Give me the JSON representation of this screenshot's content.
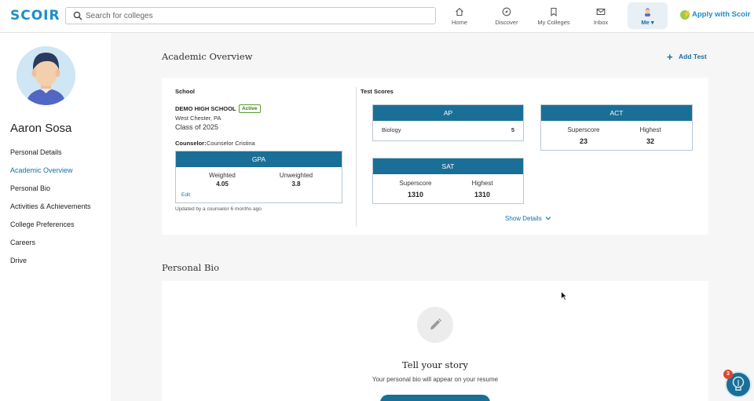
{
  "app": {
    "logo": "SCOIR"
  },
  "search": {
    "placeholder": "Search for colleges"
  },
  "nav": {
    "home": "Home",
    "discover": "Discover",
    "my_colleges": "My Colleges",
    "inbox": "Inbox",
    "me": "Me ▾",
    "apply": "Apply with Scoir"
  },
  "sidebar": {
    "name": "Aaron Sosa",
    "items": [
      {
        "label": "Personal Details"
      },
      {
        "label": "Academic Overview"
      },
      {
        "label": "Personal Bio"
      },
      {
        "label": "Activities & Achievements"
      },
      {
        "label": "College Preferences"
      },
      {
        "label": "Careers"
      },
      {
        "label": "Drive"
      }
    ]
  },
  "academic": {
    "title": "Academic Overview",
    "add_test": "Add Test",
    "school_label": "School",
    "school_name": "DEMO HIGH SCHOOL",
    "status": "Active",
    "location": "West Chester, PA",
    "class_of": "Class of 2025",
    "counselor_label": "Counselor:",
    "counselor_name": "Counselor Cristina",
    "gpa": {
      "title": "GPA",
      "weighted_label": "Weighted",
      "weighted_value": "4.05",
      "unweighted_label": "Unweighted",
      "unweighted_value": "3.8",
      "edit": "Edit",
      "updated": "Updated by a counselor 6 months ago"
    },
    "test_scores_label": "Test Scores",
    "ap": {
      "title": "AP",
      "subject": "Biology",
      "score": "5"
    },
    "act": {
      "title": "ACT",
      "superscore_label": "Superscore",
      "superscore": "23",
      "highest_label": "Highest",
      "highest": "32"
    },
    "sat": {
      "title": "SAT",
      "superscore_label": "Superscore",
      "superscore": "1310",
      "highest_label": "Highest",
      "highest": "1310"
    },
    "show_details": "Show Details"
  },
  "bio": {
    "title": "Personal Bio",
    "story_title": "Tell your story",
    "story_sub": "Your personal bio will appear on your resume"
  },
  "help": {
    "count": "3"
  },
  "colors": {
    "accent": "#1a6f96",
    "brand": "#1a8fc9",
    "active_badge": "#5c9c2e",
    "notification": "#e0452b"
  }
}
